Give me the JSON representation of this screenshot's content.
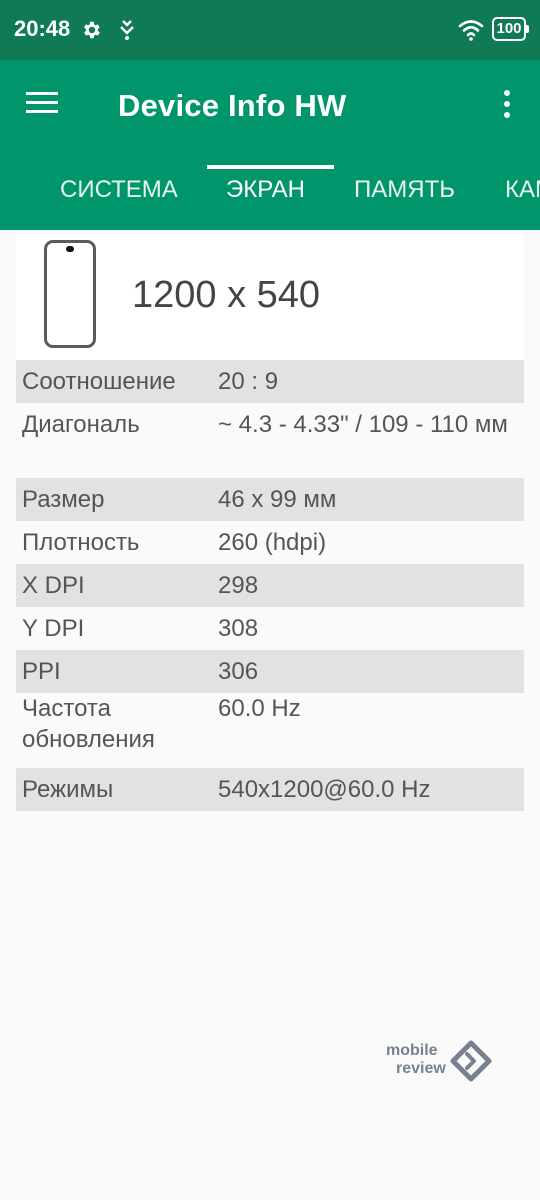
{
  "status_bar": {
    "time": "20:48",
    "icons": [
      "gear-icon",
      "notification-icon",
      "wifi-icon"
    ],
    "battery": "100"
  },
  "app_bar": {
    "title": "Device Info HW",
    "menu_icon": "hamburger-menu-icon",
    "overflow_icon": "more-vert-icon"
  },
  "tabs": [
    {
      "label": "СИСТЕМА",
      "active": false
    },
    {
      "label": "ЭКРАН",
      "active": true
    },
    {
      "label": "ПАМЯТЬ",
      "active": false
    },
    {
      "label": "КАМЕРА",
      "active": false
    }
  ],
  "screen": {
    "resolution": "1200 x 540",
    "rows": [
      {
        "label": "Соотношение",
        "value": "20 : 9"
      },
      {
        "label": "Диагональ",
        "value": "~ 4.3 - 4.33\" / 109 - 110 мм"
      },
      {
        "label": "Размер",
        "value": "46 x 99 мм"
      },
      {
        "label": "Плотность",
        "value": "260 (hdpi)"
      },
      {
        "label": "X DPI",
        "value": "298"
      },
      {
        "label": "Y DPI",
        "value": "308"
      },
      {
        "label": "PPI",
        "value": "306"
      },
      {
        "label": "Частота обновления",
        "value": "60.0 Hz"
      },
      {
        "label": "Режимы",
        "value": "540x1200@60.0 Hz"
      }
    ]
  },
  "watermark": {
    "line1": "mobile",
    "line2": "review"
  },
  "colors": {
    "appbar": "#00956b",
    "statusbar": "#107a55",
    "row_shaded": "#e2e2e2"
  }
}
